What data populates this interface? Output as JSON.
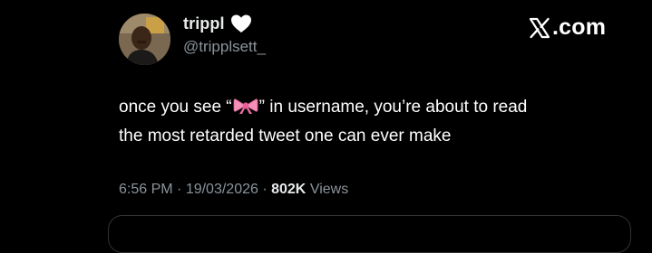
{
  "author": {
    "display_name": "trippl",
    "username": "@tripplsett_"
  },
  "brand": {
    "logo_text": ".com"
  },
  "tweet": {
    "line1_prefix": "once you see “",
    "line1_suffix": "” in username, you’re about to read",
    "line2": "the most retarded tweet one can ever make"
  },
  "meta": {
    "time": "6:56 PM",
    "separator": " · ",
    "date": "19/03/2026",
    "views_count": "802K",
    "views_label": "Views"
  },
  "icons": {
    "heart": "white-heart-icon",
    "bow": "ribbon-bow-emoji-icon",
    "logo": "x-logo-icon"
  },
  "colors": {
    "background": "#000000",
    "text_primary": "#ffffff",
    "text_secondary": "#8b949b",
    "bow_pink": "#f58fb8",
    "border": "#2f3336"
  }
}
